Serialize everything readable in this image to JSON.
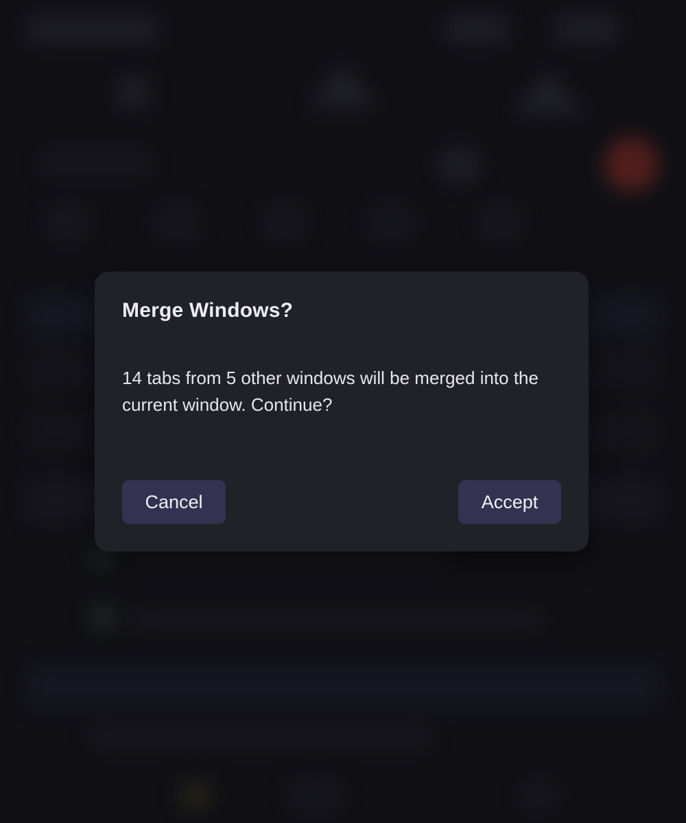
{
  "dialog": {
    "title": "Merge Windows?",
    "message": "14 tabs from 5 other windows will be merged into the current window. Continue?",
    "cancel_label": "Cancel",
    "accept_label": "Accept"
  },
  "colors": {
    "page_background": "#121217",
    "dialog_background": "#212128",
    "button_background": "#343250",
    "text": "#ececf1",
    "accent_blurred_badge": "#c0392b"
  }
}
